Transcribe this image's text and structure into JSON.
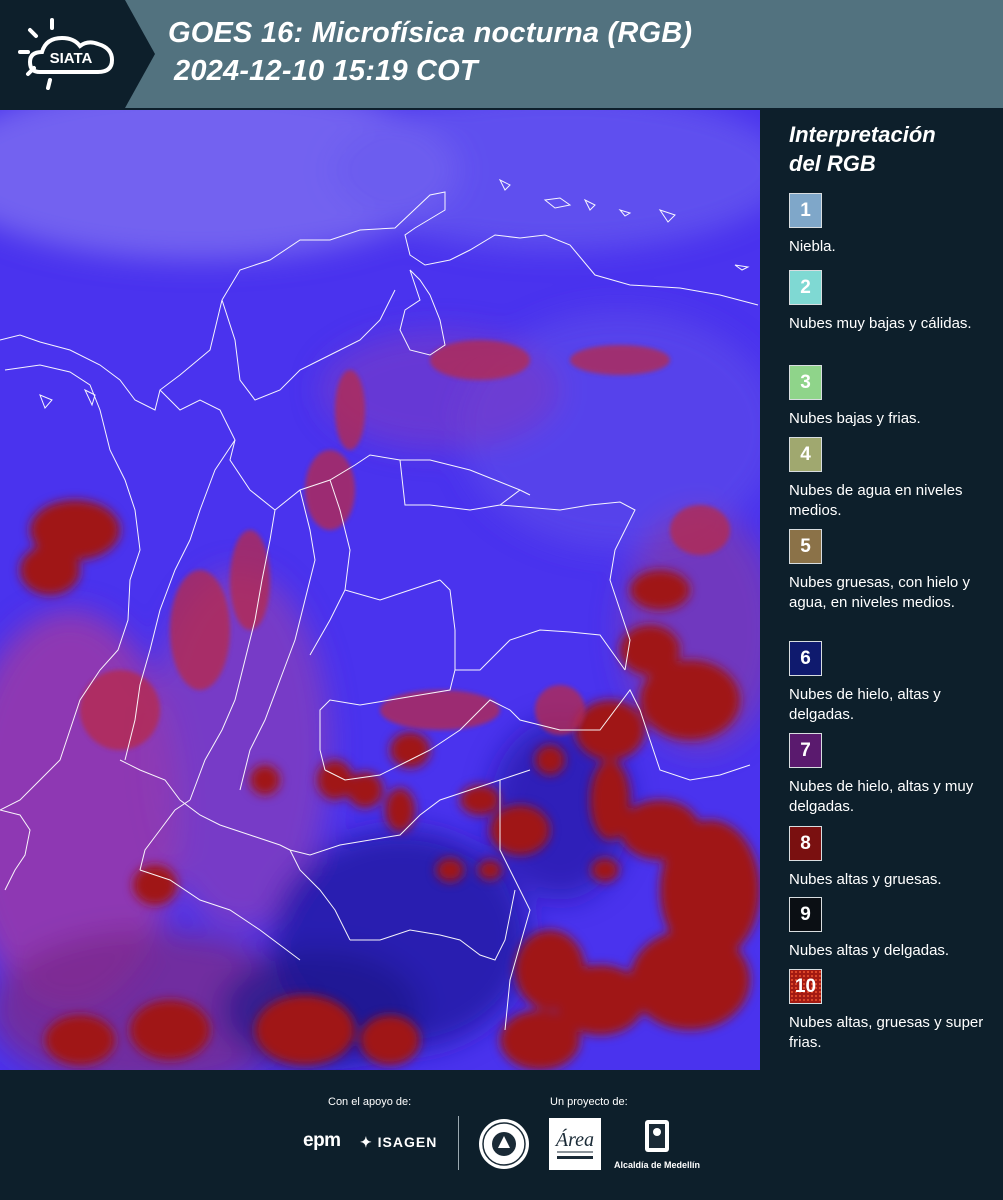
{
  "header": {
    "logo_text": "SIATA",
    "title_line1": "GOES 16: Microfísica nocturna (RGB)",
    "title_line2": "2024-12-10 15:19 COT"
  },
  "legend": {
    "title_line1": "Interpretación",
    "title_line2": "del RGB",
    "items": [
      {
        "number": "1",
        "color": "#7fa7c9",
        "label": "Niebla."
      },
      {
        "number": "2",
        "color": "#7fd9d3",
        "label": "Nubes muy bajas y cálidas."
      },
      {
        "number": "3",
        "color": "#8fd48a",
        "label": "Nubes bajas y frias."
      },
      {
        "number": "4",
        "color": "#a0a86f",
        "label": "Nubes de agua en niveles medios."
      },
      {
        "number": "5",
        "color": "#8b7248",
        "label": "Nubes gruesas, con hielo y agua, en niveles medios."
      },
      {
        "number": "6",
        "color": "#0f1a6e",
        "label": "Nubes de hielo, altas y delgadas."
      },
      {
        "number": "7",
        "color": "#5a1a6e",
        "label": "Nubes de hielo, altas y muy delgadas."
      },
      {
        "number": "8",
        "color": "#7a1010",
        "label": "Nubes altas y gruesas."
      },
      {
        "number": "9",
        "color": "#0b0f14",
        "label": "Nubes altas y delgadas."
      },
      {
        "number": "10",
        "color": "#a31a12",
        "label": "Nubes altas, gruesas y super frias."
      }
    ]
  },
  "footer": {
    "support_label": "Con el apoyo de:",
    "project_label": "Un proyecto de:",
    "sponsor_1": "epm",
    "sponsor_2": "ISAGEN",
    "partner_1": "Área Metropolitana",
    "partner_2": "Alcaldía de Medellín"
  }
}
